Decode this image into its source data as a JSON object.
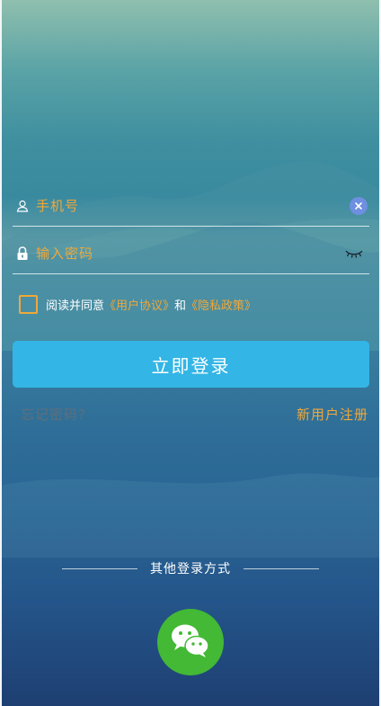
{
  "phone_field": {
    "placeholder": "手机号",
    "icon": "user-icon"
  },
  "password_field": {
    "placeholder": "输入密码",
    "icon": "lock-icon"
  },
  "agreement": {
    "prefix": "阅读并同意",
    "user_agreement": "《用户协议》",
    "connector": "和",
    "privacy_policy": "《隐私政策》"
  },
  "login_button": "立即登录",
  "forgot_password": "忘记密码?",
  "register": "新用户注册",
  "other_login": {
    "label": "其他登录方式",
    "wechat_icon": "wechat-icon"
  },
  "colors": {
    "accent_orange": "#f0a83a",
    "button_blue": "#33b5e5",
    "wechat_green": "#43b935",
    "clear_blue": "#6f8fe0"
  }
}
